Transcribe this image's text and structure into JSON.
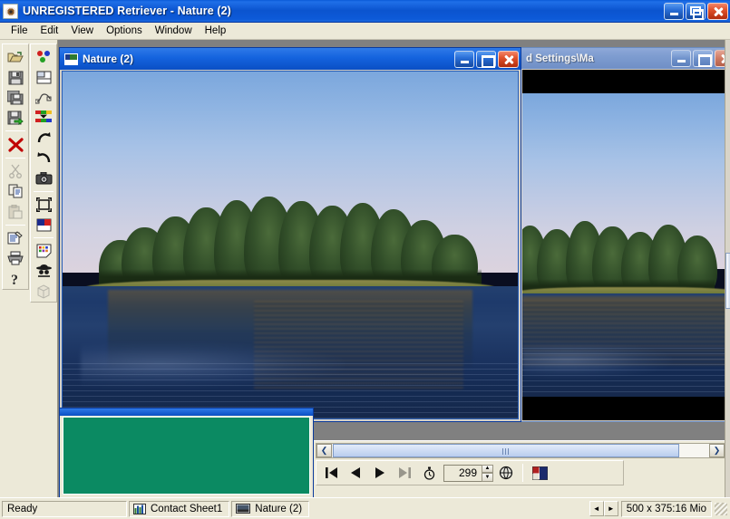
{
  "window": {
    "title": "UNREGISTERED Retriever - Nature (2)",
    "app_icon": "eye-icon",
    "controls": {
      "minimize": "Minimize",
      "restore": "Restore",
      "close": "Close"
    }
  },
  "menu": {
    "items": [
      {
        "label": "File"
      },
      {
        "label": "Edit"
      },
      {
        "label": "View"
      },
      {
        "label": "Options"
      },
      {
        "label": "Window"
      },
      {
        "label": "Help"
      }
    ]
  },
  "toolbar_left": {
    "column1": [
      {
        "name": "open-folder-icon",
        "title": "Open",
        "enabled": true
      },
      {
        "name": "save-icon",
        "title": "Save",
        "enabled": true
      },
      {
        "name": "save-as-icon",
        "title": "Save As",
        "enabled": true
      },
      {
        "name": "save-special-icon",
        "title": "Save Special",
        "enabled": true
      },
      {
        "name": "delete-icon",
        "title": "Delete",
        "enabled": true
      },
      {
        "name": "cut-icon",
        "title": "Cut",
        "enabled": false
      },
      {
        "name": "copy-icon",
        "title": "Copy",
        "enabled": true
      },
      {
        "name": "paste-icon",
        "title": "Paste",
        "enabled": false
      },
      {
        "name": "properties-icon",
        "title": "Properties",
        "enabled": true
      },
      {
        "name": "print-icon",
        "title": "Print",
        "enabled": true
      },
      {
        "name": "help-icon",
        "title": "Help",
        "enabled": true
      }
    ],
    "column2": [
      {
        "name": "color-dots-icon",
        "title": "Colors",
        "enabled": true
      },
      {
        "name": "layers-icon",
        "title": "Layers",
        "enabled": true
      },
      {
        "name": "curve-path-icon",
        "title": "Curve",
        "enabled": true
      },
      {
        "name": "palette-dropdown-icon",
        "title": "Palette",
        "enabled": true
      },
      {
        "name": "redo-icon",
        "title": "Redo",
        "enabled": true
      },
      {
        "name": "undo-icon",
        "title": "Undo",
        "enabled": true
      },
      {
        "name": "camera-icon",
        "title": "Capture",
        "enabled": true
      },
      {
        "name": "fullscreen-icon",
        "title": "Full Screen",
        "enabled": true
      },
      {
        "name": "color-adjust-icon",
        "title": "Color Adjust",
        "enabled": true
      },
      {
        "name": "swatch-icon",
        "title": "Swatches",
        "enabled": true
      },
      {
        "name": "detective-icon",
        "title": "Batch",
        "enabled": true
      },
      {
        "name": "cube-icon",
        "title": "3D",
        "enabled": false
      }
    ]
  },
  "child_windows": {
    "active": {
      "title": "Nature (2)",
      "icon": "image-thumb-icon",
      "controls": {
        "minimize": "Minimize",
        "restore": "Restore",
        "close": "Close"
      }
    },
    "background": {
      "title": "d Settings\\Ma",
      "controls": {
        "minimize": "Minimize",
        "restore": "Restore",
        "close": "Close"
      }
    },
    "contact_sheet": {
      "name": "contact-sheet-window",
      "fill_color": "#0b8a62"
    }
  },
  "navigation": {
    "first_label": "First",
    "prev_label": "Previous",
    "next_label": "Next",
    "last_label": "Last",
    "timer_label": "Timer",
    "delay_value": "299",
    "spin_up": "▲",
    "spin_down": "▼",
    "globe_label": "Browse",
    "slideshow_label": "Slide Show",
    "scroll_left": "❮",
    "scroll_right": "❯"
  },
  "status_bar": {
    "ready_text": "Ready",
    "tabs": [
      {
        "label": "Contact Sheet1",
        "icon": "contact-sheet-icon"
      },
      {
        "label": "Nature (2)",
        "icon": "image-thumb-icon"
      }
    ],
    "nav_left": "◄",
    "nav_right": "►",
    "dimensions": "500 x 375:16 Mio"
  },
  "photo": {
    "name": "nature-lake-island-photo",
    "description": "Pine tree island reflected in a calm blue lake at dusk"
  },
  "colors": {
    "title_blue": "#0b54cf",
    "menu_bg": "#ece9d8",
    "mdi_bg": "#808080",
    "teal_panel": "#0b8a62",
    "close_red": "#e0522c"
  }
}
